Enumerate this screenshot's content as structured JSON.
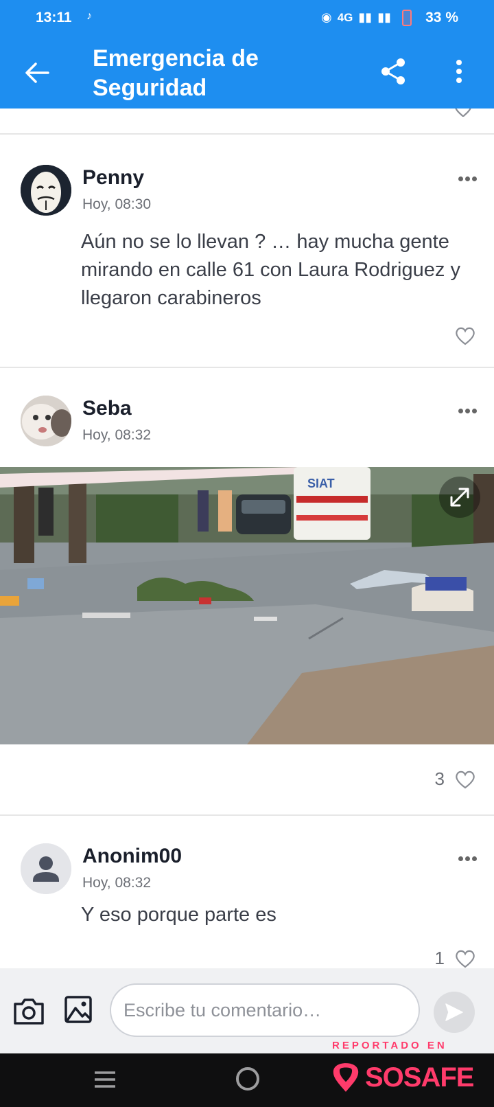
{
  "status_bar": {
    "time": "13:11",
    "network": "4G",
    "battery": "33 %"
  },
  "app_bar": {
    "title": "Emergencia de Seguridad"
  },
  "comments": [
    {
      "author": "Penny",
      "timestamp": "Hoy, 08:30",
      "text": "Aún no se lo llevan ? … hay mucha gente mirando en calle 61 con Laura Rodriguez y llegaron carabineros",
      "likes": ""
    },
    {
      "author": "Seba",
      "timestamp": "Hoy, 08:32",
      "text": "",
      "image_text": "SIAT",
      "likes": "3"
    },
    {
      "author": "Anonim00",
      "timestamp": "Hoy, 08:32",
      "text": "Y eso porque parte es",
      "likes": "1"
    }
  ],
  "composer": {
    "placeholder": "Escribe tu comentario…"
  },
  "branding": {
    "reported_label": "REPORTADO EN",
    "brand": "SOSAFE"
  },
  "colors": {
    "primary": "#1e8ef0",
    "brand": "#ff3b6b"
  }
}
